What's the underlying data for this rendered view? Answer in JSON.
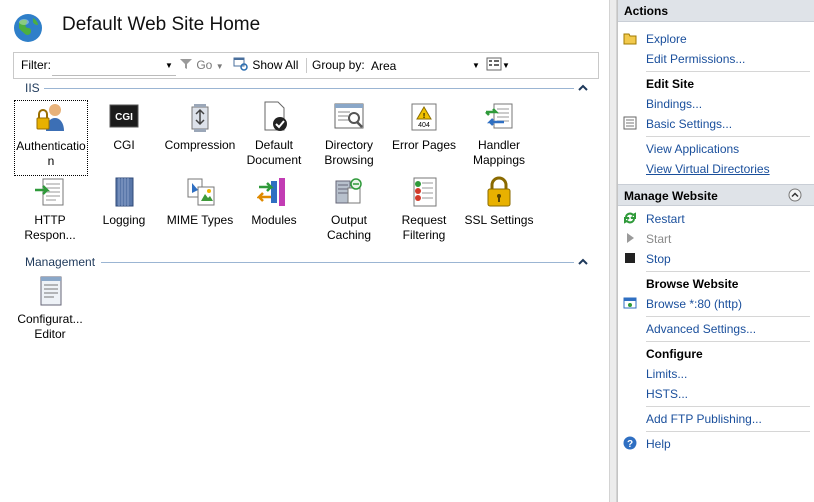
{
  "header": {
    "title": "Default Web Site Home"
  },
  "filterbar": {
    "filter_label": "Filter:",
    "filter_value": "",
    "go_label": "Go",
    "show_all_label": "Show All",
    "group_by_label": "Group by:",
    "group_by_value": "Area"
  },
  "groups": [
    {
      "title": "IIS",
      "items": [
        {
          "label": "Authentication",
          "icon": "authentication-icon"
        },
        {
          "label": "CGI",
          "icon": "cgi-icon"
        },
        {
          "label": "Compression",
          "icon": "compression-icon"
        },
        {
          "label": "Default Document",
          "icon": "default-document-icon"
        },
        {
          "label": "Directory Browsing",
          "icon": "directory-browsing-icon"
        },
        {
          "label": "Error Pages",
          "icon": "error-pages-icon"
        },
        {
          "label": "Handler Mappings",
          "icon": "handler-mappings-icon"
        },
        {
          "label": "HTTP Respon...",
          "icon": "http-response-icon"
        },
        {
          "label": "Logging",
          "icon": "logging-icon"
        },
        {
          "label": "MIME Types",
          "icon": "mime-types-icon"
        },
        {
          "label": "Modules",
          "icon": "modules-icon"
        },
        {
          "label": "Output Caching",
          "icon": "output-caching-icon"
        },
        {
          "label": "Request Filtering",
          "icon": "request-filtering-icon"
        },
        {
          "label": "SSL Settings",
          "icon": "ssl-settings-icon"
        }
      ]
    },
    {
      "title": "Management",
      "items": [
        {
          "label": "Configurat... Editor",
          "icon": "configuration-editor-icon"
        }
      ]
    }
  ],
  "actions": {
    "title": "Actions",
    "explore": "Explore",
    "edit_permissions": "Edit Permissions...",
    "edit_site_header": "Edit Site",
    "bindings": "Bindings...",
    "basic_settings": "Basic Settings...",
    "view_applications": "View Applications",
    "view_virtual_directories": "View Virtual Directories",
    "manage_website_header": "Manage Website",
    "restart": "Restart",
    "start": "Start",
    "stop": "Stop",
    "browse_website_header": "Browse Website",
    "browse_80": "Browse *:80 (http)",
    "advanced_settings": "Advanced Settings...",
    "configure_header": "Configure",
    "limits": "Limits...",
    "hsts": "HSTS...",
    "add_ftp": "Add FTP Publishing...",
    "help": "Help"
  },
  "colors": {
    "link": "#1a4f9c",
    "group_header": "#1e395b",
    "pane_header_bg": "#dfe3e8"
  }
}
